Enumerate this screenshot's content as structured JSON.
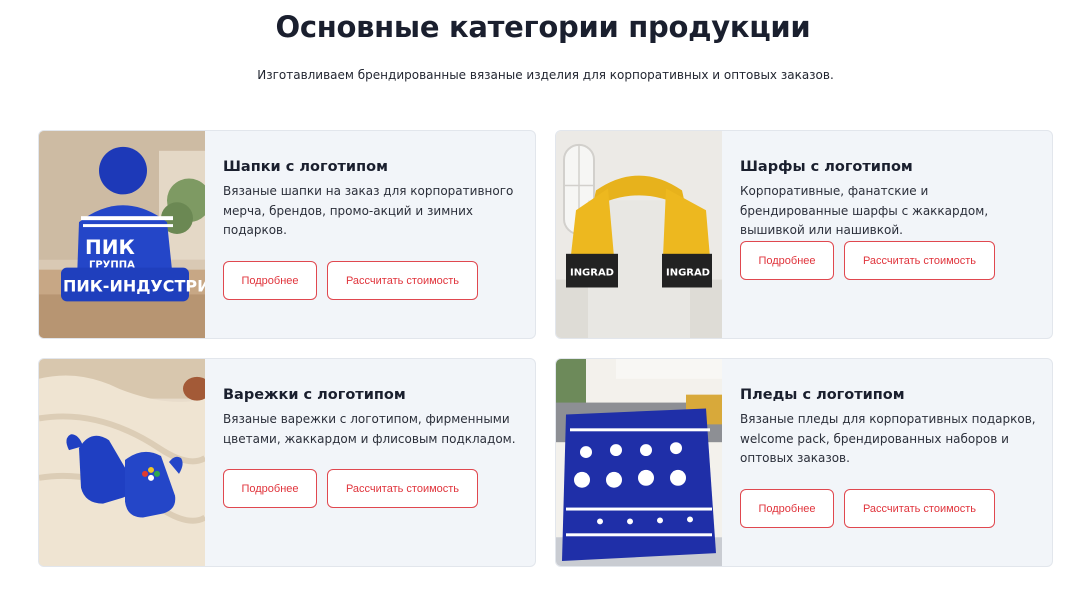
{
  "header": {
    "title": "Основные категории продукции",
    "subtitle": "Изготавливаем брендированные вязаные изделия для корпоративных и оптовых заказов."
  },
  "colors": {
    "accent": "#e0343c",
    "card_bg": "#f2f5f9",
    "title": "#1a1f2e"
  },
  "cards": [
    {
      "name": "Шапки с логотипом",
      "description": "Вязаные шапки на заказ для корпоративного мерча, брендов, промо-акций и зимних подарков.",
      "image_text_1": "ПИК",
      "image_text_2": "ГРУППА",
      "image_text_3": "ПИК-ИНДУСТРИ",
      "more_label": "Подробнее",
      "calc_label": "Рассчитать стоимость"
    },
    {
      "name": "Шарфы с логотипом",
      "description": "Корпоративные, фанатские и брендированные шарфы с жаккардом, вышивкой или нашивкой.",
      "image_text_1": "INGRAD",
      "image_text_2": "INGRAD",
      "more_label": "Подробнее",
      "calc_label": "Рассчитать стоимость"
    },
    {
      "name": "Варежки с логотипом",
      "description": "Вязаные варежки с логотипом, фирменными цветами, жаккардом и флисовым подкладом.",
      "more_label": "Подробнее",
      "calc_label": "Рассчитать стоимость"
    },
    {
      "name": "Пледы с логотипом",
      "description": "Вязаные пледы для корпоративных подарков, welcome pack, брендированных наборов и оптовых заказов.",
      "more_label": "Подробнее",
      "calc_label": "Рассчитать стоимость"
    }
  ]
}
